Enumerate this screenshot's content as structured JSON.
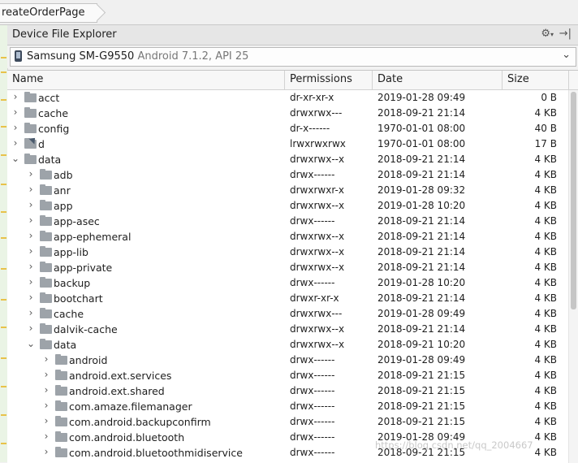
{
  "breadcrumb": "reateOrderPage",
  "panel": {
    "title": "Device File Explorer",
    "settings_icon": "gear-icon",
    "hide_icon": "hide-panel-icon"
  },
  "device": {
    "name": "Samsung SM-G9550",
    "info": "Android 7.1.2, API 25"
  },
  "columns": {
    "name": "Name",
    "permissions": "Permissions",
    "date": "Date",
    "size": "Size"
  },
  "rows": [
    {
      "name": "acct",
      "perm": "dr-xr-xr-x",
      "date": "2019-01-28 09:49",
      "size": "0 B",
      "expanded": false,
      "depth": 0,
      "link": false
    },
    {
      "name": "cache",
      "perm": "drwxrwx---",
      "date": "2018-09-21 21:14",
      "size": "4 KB",
      "expanded": false,
      "depth": 0,
      "link": false
    },
    {
      "name": "config",
      "perm": "dr-x------",
      "date": "1970-01-01 08:00",
      "size": "40 B",
      "expanded": false,
      "depth": 0,
      "link": false
    },
    {
      "name": "d",
      "perm": "lrwxrwxrwx",
      "date": "1970-01-01 08:00",
      "size": "17 B",
      "expanded": false,
      "depth": 0,
      "link": true
    },
    {
      "name": "data",
      "perm": "drwxrwx--x",
      "date": "2018-09-21 21:14",
      "size": "4 KB",
      "expanded": true,
      "depth": 0,
      "link": false
    },
    {
      "name": "adb",
      "perm": "drwx------",
      "date": "2018-09-21 21:14",
      "size": "4 KB",
      "expanded": false,
      "depth": 1,
      "link": false
    },
    {
      "name": "anr",
      "perm": "drwxrwxr-x",
      "date": "2019-01-28 09:32",
      "size": "4 KB",
      "expanded": false,
      "depth": 1,
      "link": false
    },
    {
      "name": "app",
      "perm": "drwxrwx--x",
      "date": "2019-01-28 10:20",
      "size": "4 KB",
      "expanded": false,
      "depth": 1,
      "link": false
    },
    {
      "name": "app-asec",
      "perm": "drwx------",
      "date": "2018-09-21 21:14",
      "size": "4 KB",
      "expanded": false,
      "depth": 1,
      "link": false
    },
    {
      "name": "app-ephemeral",
      "perm": "drwxrwx--x",
      "date": "2018-09-21 21:14",
      "size": "4 KB",
      "expanded": false,
      "depth": 1,
      "link": false
    },
    {
      "name": "app-lib",
      "perm": "drwxrwx--x",
      "date": "2018-09-21 21:14",
      "size": "4 KB",
      "expanded": false,
      "depth": 1,
      "link": false
    },
    {
      "name": "app-private",
      "perm": "drwxrwx--x",
      "date": "2018-09-21 21:14",
      "size": "4 KB",
      "expanded": false,
      "depth": 1,
      "link": false
    },
    {
      "name": "backup",
      "perm": "drwx------",
      "date": "2019-01-28 10:20",
      "size": "4 KB",
      "expanded": false,
      "depth": 1,
      "link": false
    },
    {
      "name": "bootchart",
      "perm": "drwxr-xr-x",
      "date": "2018-09-21 21:14",
      "size": "4 KB",
      "expanded": false,
      "depth": 1,
      "link": false
    },
    {
      "name": "cache",
      "perm": "drwxrwx---",
      "date": "2019-01-28 09:49",
      "size": "4 KB",
      "expanded": false,
      "depth": 1,
      "link": false
    },
    {
      "name": "dalvik-cache",
      "perm": "drwxrwx--x",
      "date": "2018-09-21 21:14",
      "size": "4 KB",
      "expanded": false,
      "depth": 1,
      "link": false
    },
    {
      "name": "data",
      "perm": "drwxrwx--x",
      "date": "2018-09-21 10:20",
      "size": "4 KB",
      "expanded": true,
      "depth": 1,
      "link": false
    },
    {
      "name": "android",
      "perm": "drwx------",
      "date": "2019-01-28 09:49",
      "size": "4 KB",
      "expanded": false,
      "depth": 2,
      "link": false
    },
    {
      "name": "android.ext.services",
      "perm": "drwx------",
      "date": "2018-09-21 21:15",
      "size": "4 KB",
      "expanded": false,
      "depth": 2,
      "link": false
    },
    {
      "name": "android.ext.shared",
      "perm": "drwx------",
      "date": "2018-09-21 21:15",
      "size": "4 KB",
      "expanded": false,
      "depth": 2,
      "link": false
    },
    {
      "name": "com.amaze.filemanager",
      "perm": "drwx------",
      "date": "2018-09-21 21:15",
      "size": "4 KB",
      "expanded": false,
      "depth": 2,
      "link": false
    },
    {
      "name": "com.android.backupconfirm",
      "perm": "drwx------",
      "date": "2018-09-21 21:15",
      "size": "4 KB",
      "expanded": false,
      "depth": 2,
      "link": false
    },
    {
      "name": "com.android.bluetooth",
      "perm": "drwx------",
      "date": "2019-01-28 09:49",
      "size": "4 KB",
      "expanded": false,
      "depth": 2,
      "link": false
    },
    {
      "name": "com.android.bluetoothmidiservice",
      "perm": "drwx------",
      "date": "2018-09-21 21:15",
      "size": "4 KB",
      "expanded": false,
      "depth": 2,
      "link": false
    }
  ],
  "watermark": "https://blog.csdn.net/qq_2004667"
}
